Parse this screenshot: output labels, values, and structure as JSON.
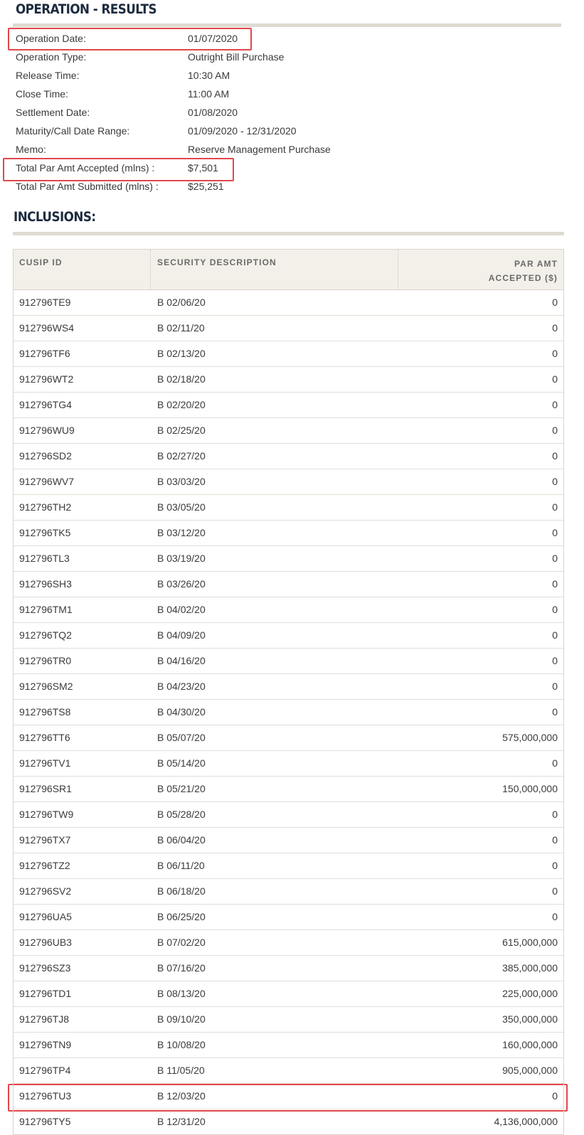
{
  "page_title": "OPERATION - RESULTS",
  "details": [
    {
      "label": "Operation Date:",
      "value": "01/07/2020"
    },
    {
      "label": "Operation Type:",
      "value": "Outright Bill Purchase"
    },
    {
      "label": "Release Time:",
      "value": "10:30 AM"
    },
    {
      "label": "Close Time:",
      "value": "11:00 AM"
    },
    {
      "label": "Settlement Date:",
      "value": "01/08/2020"
    },
    {
      "label": "Maturity/Call Date Range:",
      "value": "01/09/2020 - 12/31/2020"
    },
    {
      "label": "Memo:",
      "value": "Reserve Management Purchase"
    },
    {
      "label": "Total Par Amt Accepted (mlns) :",
      "value": "$7,501"
    },
    {
      "label": "Total Par Amt Submitted (mlns) :",
      "value": "$25,251"
    }
  ],
  "inclusions_title": "INCLUSIONS:",
  "table": {
    "headers": [
      "CUSIP ID",
      "SECURITY DESCRIPTION",
      "PAR AMT ACCEPTED ($)"
    ],
    "rows": [
      [
        "912796TE9",
        "B 02/06/20",
        "0"
      ],
      [
        "912796WS4",
        "B 02/11/20",
        "0"
      ],
      [
        "912796TF6",
        "B 02/13/20",
        "0"
      ],
      [
        "912796WT2",
        "B 02/18/20",
        "0"
      ],
      [
        "912796TG4",
        "B 02/20/20",
        "0"
      ],
      [
        "912796WU9",
        "B 02/25/20",
        "0"
      ],
      [
        "912796SD2",
        "B 02/27/20",
        "0"
      ],
      [
        "912796WV7",
        "B 03/03/20",
        "0"
      ],
      [
        "912796TH2",
        "B 03/05/20",
        "0"
      ],
      [
        "912796TK5",
        "B 03/12/20",
        "0"
      ],
      [
        "912796TL3",
        "B 03/19/20",
        "0"
      ],
      [
        "912796SH3",
        "B 03/26/20",
        "0"
      ],
      [
        "912796TM1",
        "B 04/02/20",
        "0"
      ],
      [
        "912796TQ2",
        "B 04/09/20",
        "0"
      ],
      [
        "912796TR0",
        "B 04/16/20",
        "0"
      ],
      [
        "912796SM2",
        "B 04/23/20",
        "0"
      ],
      [
        "912796TS8",
        "B 04/30/20",
        "0"
      ],
      [
        "912796TT6",
        "B 05/07/20",
        "575,000,000"
      ],
      [
        "912796TV1",
        "B 05/14/20",
        "0"
      ],
      [
        "912796SR1",
        "B 05/21/20",
        "150,000,000"
      ],
      [
        "912796TW9",
        "B 05/28/20",
        "0"
      ],
      [
        "912796TX7",
        "B 06/04/20",
        "0"
      ],
      [
        "912796TZ2",
        "B 06/11/20",
        "0"
      ],
      [
        "912796SV2",
        "B 06/18/20",
        "0"
      ],
      [
        "912796UA5",
        "B 06/25/20",
        "0"
      ],
      [
        "912796UB3",
        "B 07/02/20",
        "615,000,000"
      ],
      [
        "912796SZ3",
        "B 07/16/20",
        "385,000,000"
      ],
      [
        "912796TD1",
        "B 08/13/20",
        "225,000,000"
      ],
      [
        "912796TJ8",
        "B 09/10/20",
        "350,000,000"
      ],
      [
        "912796TN9",
        "B 10/08/20",
        "160,000,000"
      ],
      [
        "912796TP4",
        "B 11/05/20",
        "905,000,000"
      ],
      [
        "912796TU3",
        "B 12/03/20",
        "0"
      ],
      [
        "912796TY5",
        "B 12/31/20",
        "4,136,000,000"
      ]
    ]
  },
  "highlight_color": "#e0474c"
}
